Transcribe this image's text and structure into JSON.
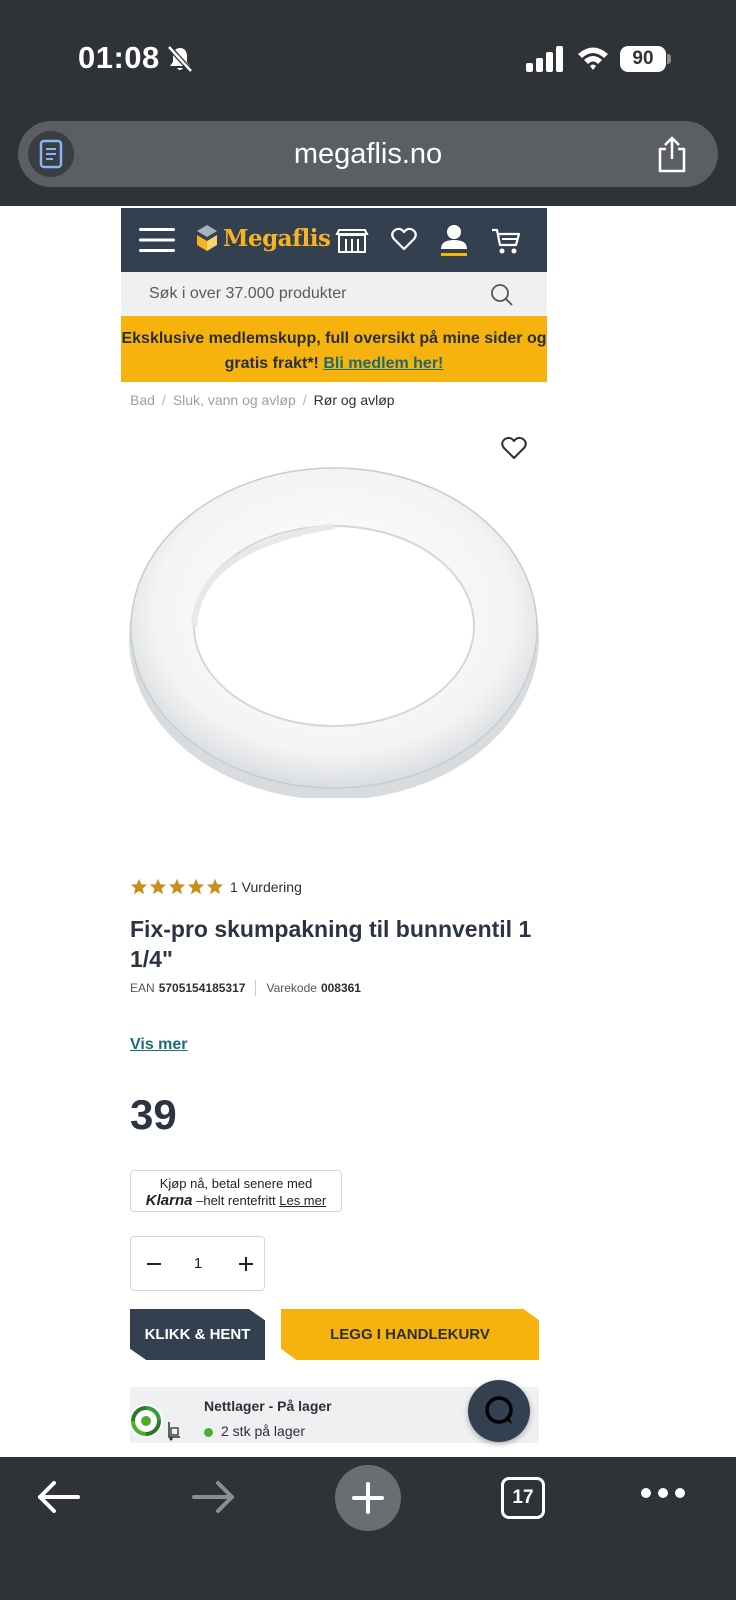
{
  "status_bar": {
    "time": "01:08",
    "battery": "90"
  },
  "browser": {
    "url": "megaflis.no",
    "tab_count": "17"
  },
  "site": {
    "logo_text": "Megaflis",
    "search_placeholder": "Søk i over 37.000 produkter",
    "promo_text": "Eksklusive medlemskupp, full oversikt på mine sider og gratis frakt",
    "promo_mark": "*!",
    "promo_link": "Bli medlem her!",
    "brand_color": "#334050",
    "accent_color": "#f6b30e"
  },
  "breadcrumb": [
    "Bad",
    "Sluk, vann og avløp",
    "Rør og avløp"
  ],
  "product": {
    "rating_stars": 5,
    "rating_text": "1 Vurdering",
    "title": "Fix-pro skumpakning til bunnventil 1 1/4\"",
    "ean_label": "EAN",
    "ean": "5705154185317",
    "code_label": "Varekode",
    "code": "008361",
    "show_more": "Vis mer",
    "price": "39",
    "quantity": "1"
  },
  "klarna": {
    "line1": "Kjøp nå, betal senere med",
    "brand": "Klarna",
    "line2": "–helt rentefritt",
    "link": "Les mer"
  },
  "buttons": {
    "pickup": "KLIKK & HENT",
    "add_to_cart": "LEGG I HANDLEKURV"
  },
  "stock": {
    "title": "Nettlager - På lager",
    "count": "2 stk på lager",
    "status_color": "#4cae2d"
  }
}
